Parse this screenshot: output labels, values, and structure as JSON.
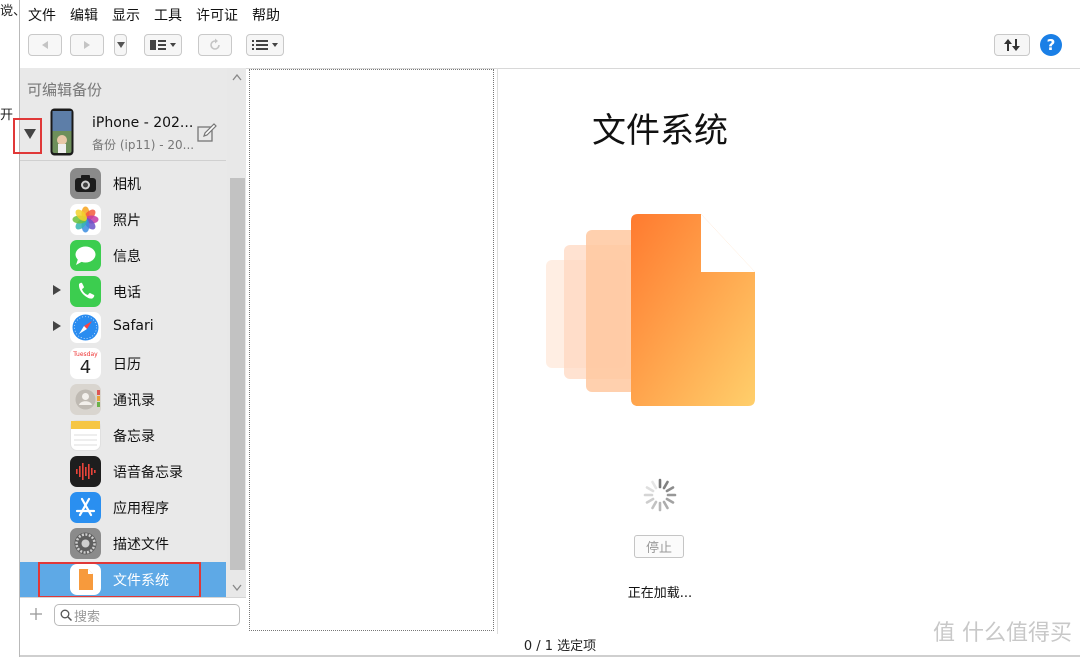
{
  "edge": {
    "top_text": "谠、",
    "mid_text": "开"
  },
  "menu": [
    "文件",
    "编辑",
    "显示",
    "工具",
    "许可证",
    "帮助"
  ],
  "toolbar": {
    "help": "?"
  },
  "sidebar": {
    "header": "可编辑备份",
    "device": {
      "name": "iPhone - 202...",
      "subtitle": "备份 (ip11) - 20..."
    },
    "items": [
      {
        "label": "相机",
        "icon": "camera-icon"
      },
      {
        "label": "照片",
        "icon": "photos-icon"
      },
      {
        "label": "信息",
        "icon": "messages-icon"
      },
      {
        "label": "电话",
        "icon": "phone-icon"
      },
      {
        "label": "Safari",
        "icon": "safari-icon"
      },
      {
        "label": "日历",
        "icon": "calendar-icon",
        "day_name": "Tuesday",
        "day_num": "4"
      },
      {
        "label": "通讯录",
        "icon": "contacts-icon"
      },
      {
        "label": "备忘录",
        "icon": "notes-icon"
      },
      {
        "label": "语音备忘录",
        "icon": "voice-memos-icon"
      },
      {
        "label": "应用程序",
        "icon": "app-store-icon"
      },
      {
        "label": "描述文件",
        "icon": "settings-icon"
      },
      {
        "label": "文件系统",
        "icon": "files-icon"
      }
    ],
    "search_placeholder": "搜索"
  },
  "content": {
    "title": "文件系统",
    "stop_label": "停止",
    "loading_text": "正在加载...",
    "status": "0 / 1 选定项"
  },
  "watermark": "值 什么值得买",
  "colors": {
    "accent": "#1a7fe6",
    "selection": "#5ea9e6",
    "highlight": "#e03838"
  }
}
